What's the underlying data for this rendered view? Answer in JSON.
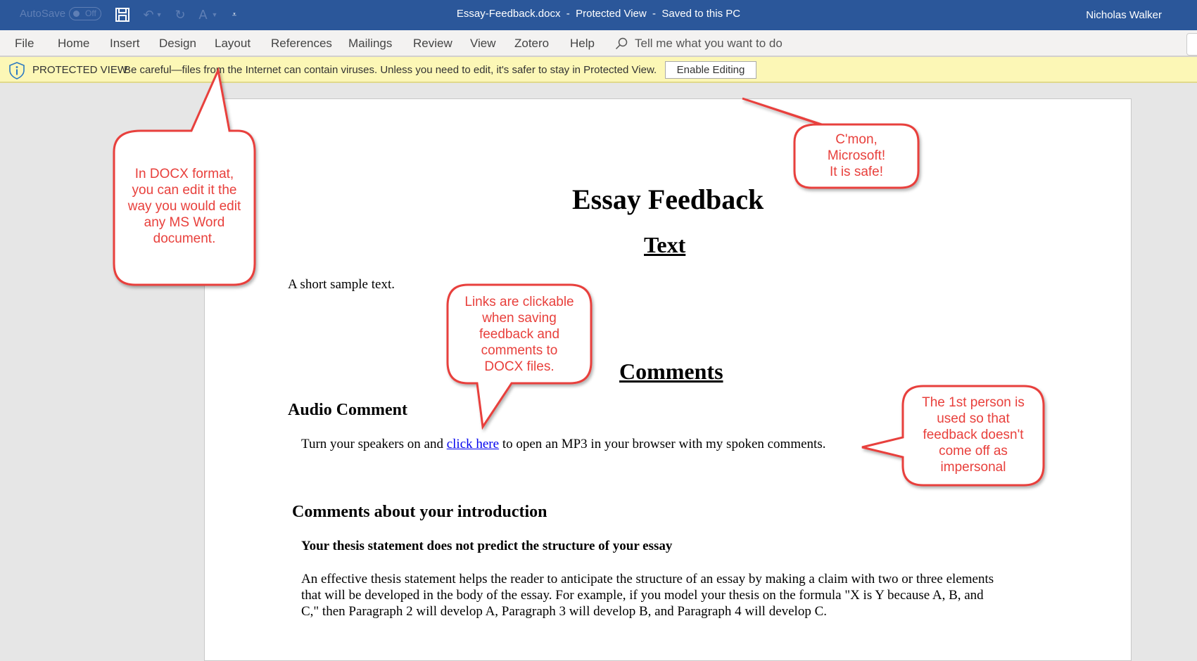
{
  "titlebar": {
    "autosave_label": "AutoSave",
    "autosave_state": "Off",
    "document_title": "Essay-Feedback.docx  -  Protected View  -  Saved to this PC",
    "user_name": "Nicholas Walker",
    "quick_access_icons": [
      "save-icon",
      "undo-icon",
      "redo-icon",
      "spelling-icon",
      "customize-icon"
    ]
  },
  "ribbon": {
    "tabs": [
      {
        "label": "File"
      },
      {
        "label": "Home"
      },
      {
        "label": "Insert"
      },
      {
        "label": "Design"
      },
      {
        "label": "Layout"
      },
      {
        "label": "References"
      },
      {
        "label": "Mailings"
      },
      {
        "label": "Review"
      },
      {
        "label": "View"
      },
      {
        "label": "Zotero"
      },
      {
        "label": "Help"
      }
    ],
    "tell_me_placeholder": "Tell me what you want to do"
  },
  "protected_view": {
    "title": "PROTECTED VIEW",
    "message": "Be careful—files from the Internet can contain viruses. Unless you need to edit, it's safer to stay in Protected View.",
    "enable_button": "Enable Editing"
  },
  "document": {
    "title": "Essay Feedback",
    "section_text_heading": "Text",
    "sample_text": "A short sample text.",
    "section_comments_heading": "Comments",
    "audio_heading": "Audio Comment",
    "audio_before": "Turn your speakers on and ",
    "audio_link": "click here",
    "audio_after": " to open an MP3 in your browser with my spoken comments.",
    "intro_heading": "Comments about your introduction",
    "thesis_heading": "Your thesis statement does not predict the structure of your essay",
    "thesis_lines": [
      "An effective thesis statement helps the reader to anticipate the structure of an essay by making a claim with two or three elements",
      "that will be developed in the body of the essay. For example, if you model your thesis on the formula \"X is Y because A, B, and",
      "C,\" then Paragraph 2 will develop A, Paragraph 3 will develop B, and Paragraph 4 will develop C."
    ]
  },
  "callouts": {
    "docx_edit": [
      "In DOCX format,",
      "you can edit it the",
      "way you would edit",
      "any MS Word",
      "document."
    ],
    "microsoft": [
      "C'mon,",
      "Microsoft!",
      "It is safe!"
    ],
    "links": [
      "Links are clickable",
      "when saving",
      "feedback and",
      "comments to",
      "DOCX files."
    ],
    "first_person": [
      "The 1st person is",
      "used so that",
      "feedback doesn't",
      "come off as",
      "impersonal"
    ],
    "color": "#e8403c"
  }
}
